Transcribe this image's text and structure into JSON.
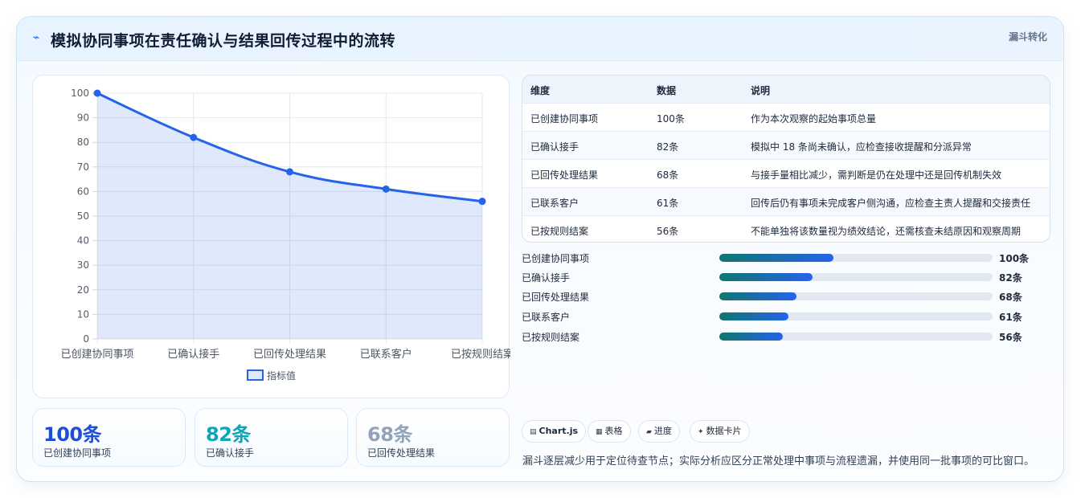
{
  "header": {
    "icon": "trend-icon",
    "title": "模拟协同事项在责任确认与结果回传过程中的流转",
    "tag": "漏斗转化"
  },
  "chart_data": {
    "type": "line",
    "categories": [
      "已创建协同事项",
      "已确认接手",
      "已回传处理结果",
      "已联系客户",
      "已按规则结案"
    ],
    "series": [
      {
        "name": "指标值",
        "values": [
          100,
          82,
          68,
          61,
          56
        ]
      }
    ],
    "ylim": [
      0,
      100
    ],
    "yticks": [
      0,
      10,
      20,
      30,
      40,
      50,
      60,
      70,
      80,
      90,
      100
    ],
    "fill": true,
    "legend": "bottom",
    "grid": true,
    "color": "#2563eb"
  },
  "kpis": [
    {
      "value": "100条",
      "label": "已创建协同事项",
      "color": "#1d4ed8"
    },
    {
      "value": "82条",
      "label": "已确认接手",
      "color": "#0fa5b7"
    },
    {
      "value": "68条",
      "label": "已回传处理结果",
      "color": "#94a3b8"
    }
  ],
  "table": {
    "headers": [
      "维度",
      "数据",
      "说明"
    ],
    "rows": [
      [
        "已创建协同事项",
        "100条",
        "作为本次观察的起始事项总量"
      ],
      [
        "已确认接手",
        "82条",
        "模拟中 18 条尚未确认，应检查接收提醒和分派异常"
      ],
      [
        "已回传处理结果",
        "68条",
        "与接手量相比减少，需判断是仍在处理中还是回传机制失效"
      ],
      [
        "已联系客户",
        "61条",
        "回传后仍有事项未完成客户侧沟通，应检查主责人提醒和交接责任"
      ],
      [
        "已按规则结案",
        "56条",
        "不能单独将该数量视为绩效结论，还需核查未结原因和观察周期"
      ]
    ]
  },
  "progress": [
    {
      "label": "已创建协同事项",
      "value": "100条",
      "fraction": 0.4167
    },
    {
      "label": "已确认接手",
      "value": "82条",
      "fraction": 0.3417
    },
    {
      "label": "已回传处理结果",
      "value": "68条",
      "fraction": 0.2833
    },
    {
      "label": "已联系客户",
      "value": "61条",
      "fraction": 0.2542
    },
    {
      "label": "已按规则结案",
      "value": "56条",
      "fraction": 0.2333
    }
  ],
  "chips": [
    {
      "icon": "chart-icon",
      "glyph": "▤",
      "label": "Chart.js",
      "bold": true
    },
    {
      "icon": "table-icon",
      "glyph": "▦",
      "label": "表格"
    },
    {
      "icon": "progress-icon",
      "glyph": "▰",
      "label": "进度"
    },
    {
      "icon": "sparkle-icon",
      "glyph": "✦",
      "label": "数据卡片"
    }
  ],
  "note": "漏斗逐层减少用于定位待查节点；实际分析应区分正常处理中事项与流程遗漏，并使用同一批事项的可比窗口。"
}
